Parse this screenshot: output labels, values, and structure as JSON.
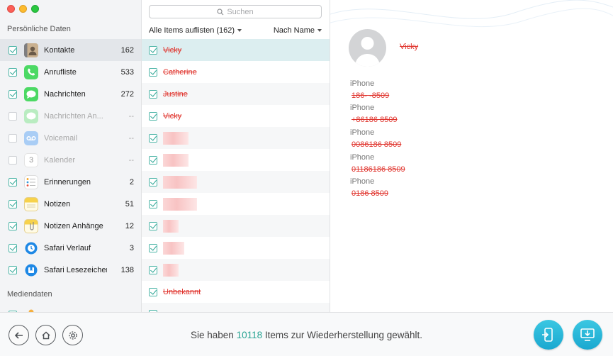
{
  "sidebar": {
    "section_personal": "Persönliche Daten",
    "section_media": "Mediendaten",
    "items": [
      {
        "label": "Kontakte",
        "count": "162",
        "checked": true,
        "icon": "contacts-icon"
      },
      {
        "label": "Anrufliste",
        "count": "533",
        "checked": true,
        "icon": "phone-icon"
      },
      {
        "label": "Nachrichten",
        "count": "272",
        "checked": true,
        "icon": "messages-icon"
      },
      {
        "label": "Nachrichten An...",
        "count": "--",
        "checked": false,
        "icon": "messages-attachment-icon"
      },
      {
        "label": "Voicemail",
        "count": "--",
        "checked": false,
        "icon": "voicemail-icon"
      },
      {
        "label": "Kalender",
        "count": "--",
        "checked": false,
        "icon": "calendar-icon"
      },
      {
        "label": "Erinnerungen",
        "count": "2",
        "checked": true,
        "icon": "reminders-icon"
      },
      {
        "label": "Notizen",
        "count": "51",
        "checked": true,
        "icon": "notes-icon"
      },
      {
        "label": "Notizen Anhänge",
        "count": "12",
        "checked": true,
        "icon": "notes-attachment-icon"
      },
      {
        "label": "Safari Verlauf",
        "count": "3",
        "checked": true,
        "icon": "safari-history-icon"
      },
      {
        "label": "Safari Lesezeichen",
        "count": "138",
        "checked": true,
        "icon": "safari-bookmarks-icon"
      }
    ],
    "calendar_day": "3"
  },
  "list": {
    "search_placeholder": "Suchen",
    "filter_label": "Alle Items auflisten (162)",
    "sort_label": "Nach Name",
    "rows": [
      {
        "name": "Vicky"
      },
      {
        "name": "Catherine"
      },
      {
        "name": "Justine"
      },
      {
        "name": "Vicky"
      },
      {
        "name": ""
      },
      {
        "name": ""
      },
      {
        "name": ""
      },
      {
        "name": ""
      },
      {
        "name": ""
      },
      {
        "name": ""
      },
      {
        "name": ""
      },
      {
        "name": "Unbekannt"
      }
    ]
  },
  "detail": {
    "name": "Vicky",
    "phones": [
      {
        "label": "iPhone",
        "value": "186-        -8509"
      },
      {
        "label": "iPhone",
        "value": "+86186             8509"
      },
      {
        "label": "iPhone",
        "value": "0086186              8509"
      },
      {
        "label": "iPhone",
        "value": "01186186           8509"
      },
      {
        "label": "iPhone",
        "value": "0186              8509"
      }
    ]
  },
  "footer": {
    "status_prefix": "Sie haben",
    "status_count": "10118",
    "status_suffix": "Items zur Wiederherstellung gewählt."
  },
  "colors": {
    "accent": "#27a392",
    "deleted": "#e0342d",
    "button": "#1aa8d0"
  }
}
